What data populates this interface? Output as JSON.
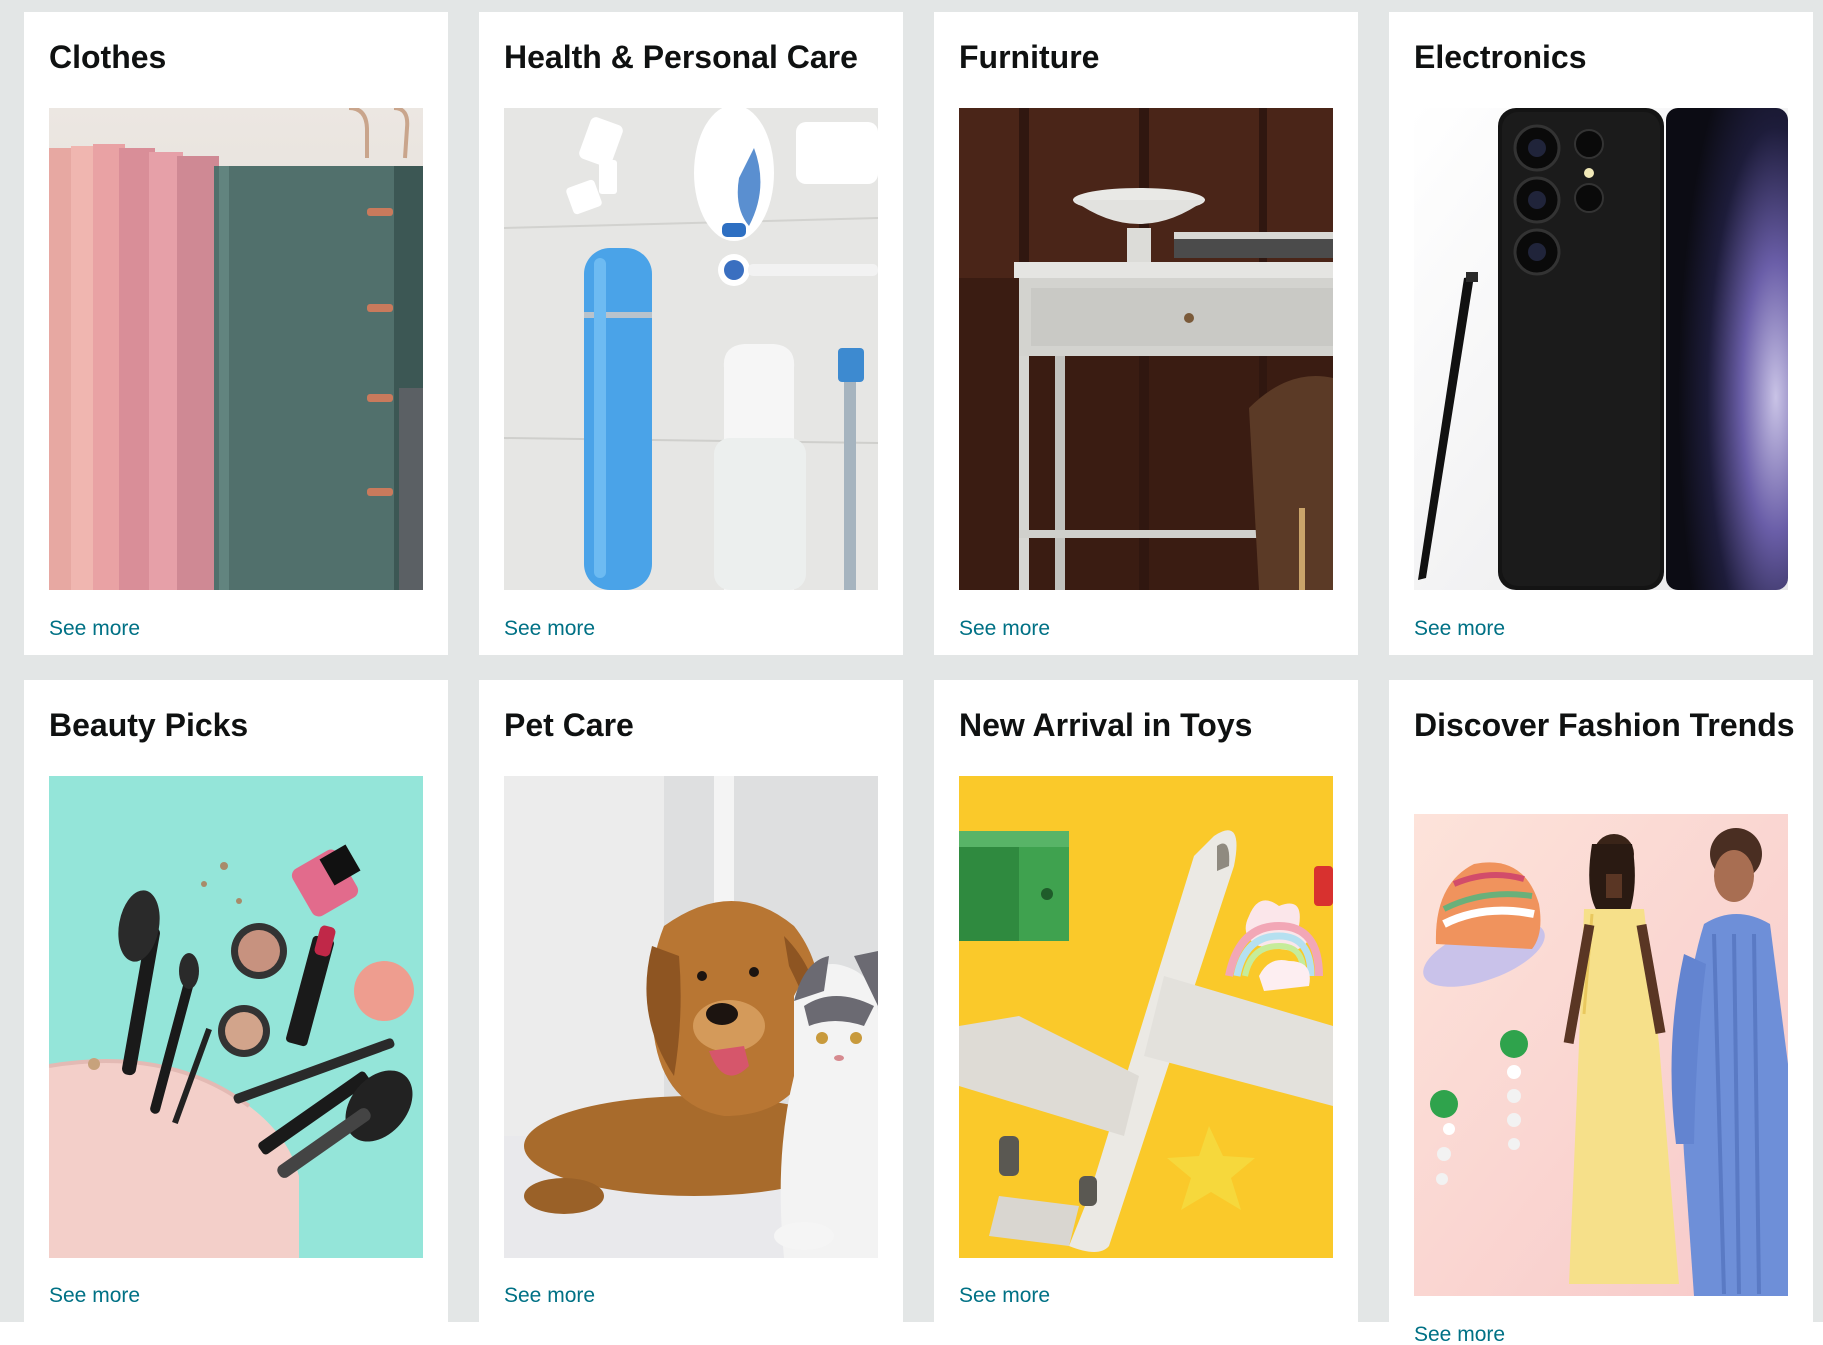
{
  "cards": [
    {
      "title": "Clothes",
      "link": "See more",
      "image": "hanging-folded-clothes-image"
    },
    {
      "title": "Health & Personal Care",
      "link": "See more",
      "image": "personal-care-products-image"
    },
    {
      "title": "Furniture",
      "link": "See more",
      "image": "desk-with-drawer-image"
    },
    {
      "title": "Electronics",
      "link": "See more",
      "image": "smartphone-with-stylus-image"
    },
    {
      "title": "Beauty Picks",
      "link": "See more",
      "image": "makeup-brushes-and-cosmetics-image"
    },
    {
      "title": "Pet Care",
      "link": "See more",
      "image": "dog-and-cat-image"
    },
    {
      "title": "New Arrival in Toys",
      "link": "See more",
      "image": "toy-airplane-image"
    },
    {
      "title": "Discover Fashion Trends",
      "link": "See more",
      "image": "fashion-models-and-accessories-image"
    }
  ],
  "colors": {
    "page_background": "#e3e6e6",
    "card_background": "#ffffff",
    "title_text": "#0f1111",
    "link_text": "#007185"
  }
}
